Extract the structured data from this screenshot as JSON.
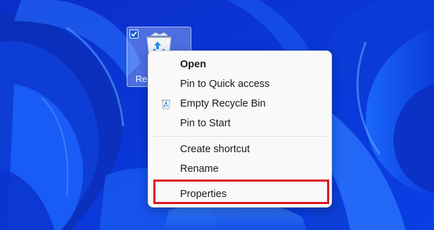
{
  "desktop": {
    "recycle_bin": {
      "label": "Recycle Bin",
      "icon": "recycle-bin-icon",
      "selected": true
    }
  },
  "context_menu": {
    "items": [
      {
        "label": "Open",
        "bold": true
      },
      {
        "label": "Pin to Quick access"
      },
      {
        "label": "Empty Recycle Bin",
        "icon": "recycle-bin-small-icon"
      },
      {
        "label": "Pin to Start"
      },
      {
        "label": "Create shortcut"
      },
      {
        "label": "Rename"
      },
      {
        "label": "Properties",
        "highlighted": true
      }
    ]
  },
  "colors": {
    "highlight_border": "#e0141e",
    "menu_background": "#f9f9f9",
    "wallpaper_base": "#0a36d8"
  }
}
